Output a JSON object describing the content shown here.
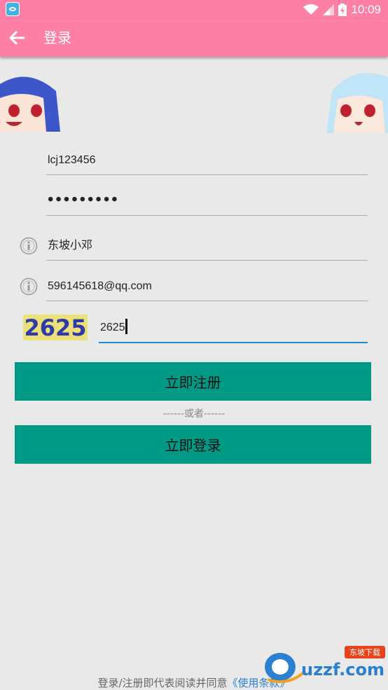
{
  "status_bar": {
    "time": "10:09"
  },
  "toolbar": {
    "title": "登录",
    "back_icon": "arrow-left-icon"
  },
  "form": {
    "username": "lcj123456",
    "password_masked": "•••••••••",
    "nickname": "东坡小邓",
    "email": "596145618@qq.com",
    "captcha_image_text": "2625",
    "captcha_input": "2625"
  },
  "buttons": {
    "register": "立即注册",
    "login": "立即登录"
  },
  "divider_text": "------或者------",
  "footer": {
    "text": "登录/注册即代表阅读并同意",
    "terms_link": "《使用条款》"
  },
  "watermark": {
    "brand": "uzzf.com",
    "tag": "东坡下载"
  },
  "colors": {
    "header": "#ff80a6",
    "button": "#009985",
    "accent": "#1e88c8"
  }
}
